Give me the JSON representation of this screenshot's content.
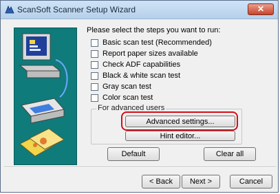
{
  "window": {
    "title": "ScanSoft Scanner Setup Wizard",
    "close_glyph": "✕"
  },
  "main": {
    "prompt": "Please select the steps you want to run:",
    "checkboxes": [
      {
        "label": "Basic scan test (Recommended)"
      },
      {
        "label": "Report paper sizes available"
      },
      {
        "label": "Check ADF capabilities"
      },
      {
        "label": "Black & white scan test"
      },
      {
        "label": "Gray scan test"
      },
      {
        "label": "Color scan test"
      }
    ],
    "group_label": "For advanced users",
    "advanced_settings": "Advanced settings...",
    "hint_editor": "Hint editor...",
    "default": "Default",
    "clear_all": "Clear all"
  },
  "footer": {
    "back": "< Back",
    "next": "Next >",
    "cancel": "Cancel"
  },
  "colors": {
    "highlight": "#d40d16",
    "art_background": "#0f7b7b"
  }
}
